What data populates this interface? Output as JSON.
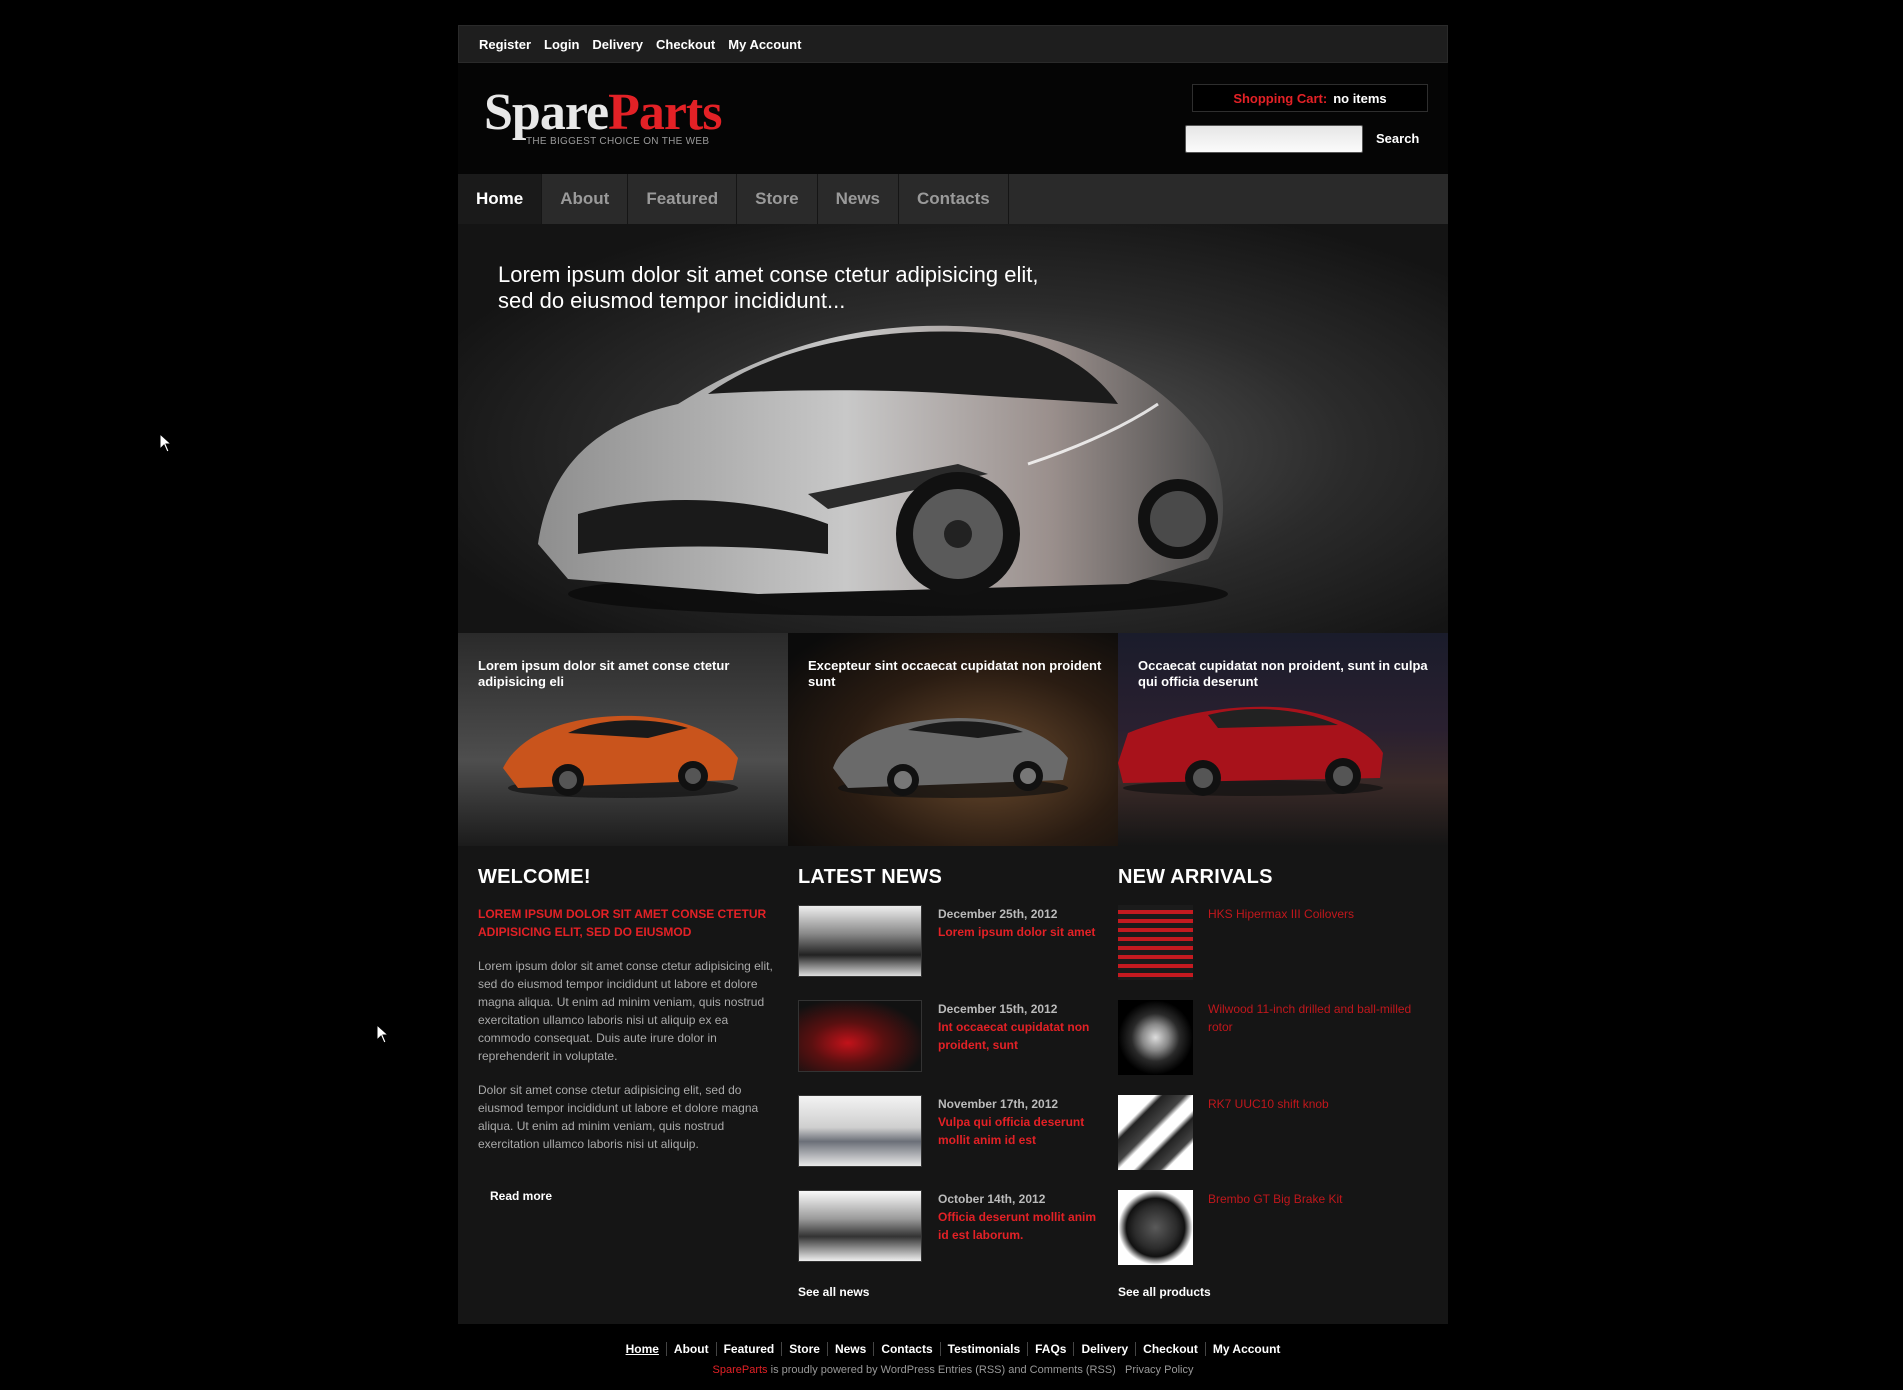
{
  "topbar": {
    "links": [
      "Register",
      "Login",
      "Delivery",
      "Checkout",
      "My Account"
    ]
  },
  "header": {
    "logo_part1": "Spare",
    "logo_part2": "Parts",
    "tagline": "THE BIGGEST CHOICE ON THE WEB",
    "cart_label": "Shopping Cart:",
    "cart_value": "no items",
    "search_button": "Search",
    "search_value": ""
  },
  "nav": {
    "items": [
      "Home",
      "About",
      "Featured",
      "Store",
      "News",
      "Contacts"
    ],
    "active": "Home"
  },
  "hero": {
    "text_line1": "Lorem ipsum dolor sit amet conse ctetur adipisicing elit,",
    "text_line2": "sed do eiusmod tempor incididunt..."
  },
  "tiles": [
    {
      "caption": "Lorem ipsum dolor sit amet conse ctetur adipisicing eli"
    },
    {
      "caption": "Excepteur sint occaecat cupidatat non proident sunt"
    },
    {
      "caption": "Occaecat cupidatat non proident, sunt in culpa qui officia deserunt"
    }
  ],
  "welcome": {
    "title": "WELCOME!",
    "subtitle": "LOREM IPSUM DOLOR SIT AMET CONSE CTETUR ADIPISICING ELIT, SED DO EIUSMOD",
    "para1": "Lorem ipsum dolor sit amet conse ctetur adipisicing elit, sed do eiusmod tempor incididunt ut labore et dolore magna aliqua. Ut enim ad minim veniam, quis nostrud exercitation ullamco laboris nisi ut aliquip ex ea commodo consequat. Duis aute irure dolor in reprehenderit in voluptate.",
    "para2": "Dolor sit amet conse ctetur adipisicing elit, sed do eiusmod tempor incididunt ut labore et dolore magna aliqua. Ut enim ad minim veniam, quis nostrud exercitation ullamco laboris nisi ut aliquip.",
    "read_more": "Read more"
  },
  "news": {
    "title": "LATEST NEWS",
    "items": [
      {
        "date": "December 25th, 2012",
        "title": "Lorem ipsum dolor sit amet"
      },
      {
        "date": "December 15th, 2012",
        "title": "Int occaecat cupidatat non proident, sunt"
      },
      {
        "date": "November 17th, 2012",
        "title": "Vulpa qui officia deserunt mollit anim id est"
      },
      {
        "date": "October 14th, 2012",
        "title": "Officia deserunt mollit anim id est laborum."
      }
    ],
    "see_all": "See all news"
  },
  "arrivals": {
    "title": "NEW ARRIVALS",
    "items": [
      {
        "name": "HKS Hipermax III Coilovers"
      },
      {
        "name": "Wilwood 11-inch drilled and ball-milled rotor"
      },
      {
        "name": "RK7 UUC10 shift knob"
      },
      {
        "name": "Brembo GT Big Brake Kit"
      }
    ],
    "see_all": "See all products"
  },
  "footer": {
    "links": [
      "Home",
      "About",
      "Featured",
      "Store",
      "News",
      "Contacts",
      "Testimonials",
      "FAQs",
      "Delivery",
      "Checkout",
      "My Account"
    ],
    "brand": "SpareParts",
    "powered": " is proudly powered by WordPress Entries (RSS) and Comments (RSS)",
    "privacy": "Privacy Policy"
  },
  "colors": {
    "accent": "#e32126",
    "background": "#000000",
    "panel": "#151515"
  }
}
